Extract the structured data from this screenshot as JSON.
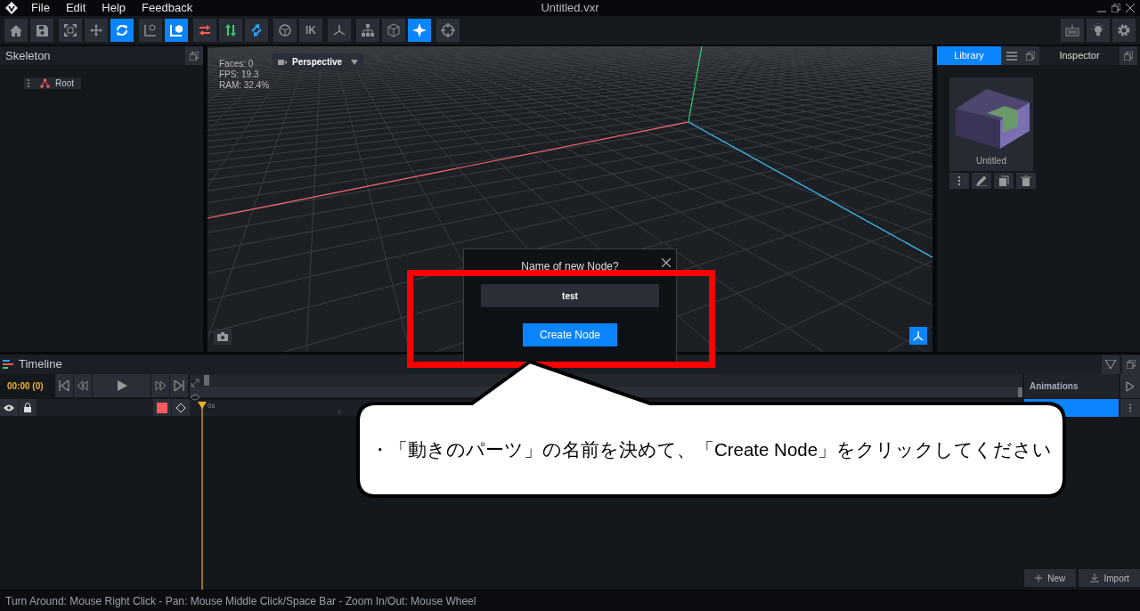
{
  "app": {
    "title": "Untitled.vxr",
    "menu": [
      "File",
      "Edit",
      "Help",
      "Feedback"
    ]
  },
  "toolbar": {
    "groups": [
      {
        "buttons": [
          {
            "selected": false
          },
          {
            "selected": false
          }
        ]
      },
      {
        "buttons": [
          {
            "selected": false
          },
          {
            "selected": false
          },
          {
            "selected": true
          }
        ]
      },
      {
        "buttons": [
          {
            "selected": false
          },
          {
            "selected": true
          }
        ]
      },
      {
        "buttons": [
          {
            "selected": false
          },
          {
            "selected": false
          },
          {
            "selected": false
          }
        ]
      },
      {
        "buttons": [
          {
            "selected": false
          },
          {
            "label": "IK",
            "selected": false
          }
        ]
      },
      {
        "buttons": [
          {
            "selected": false
          }
        ]
      },
      {
        "buttons": [
          {
            "selected": false
          },
          {
            "selected": false
          },
          {
            "selected": true
          }
        ]
      },
      {
        "buttons": [
          {
            "selected": false
          }
        ]
      }
    ],
    "right": [
      {
        "selected": false
      },
      {
        "selected": false
      },
      {
        "selected": false
      }
    ]
  },
  "skeleton": {
    "title": "Skeleton",
    "nodes": [
      {
        "label": "Root"
      }
    ]
  },
  "viewport": {
    "stats": [
      "Faces: 0",
      "FPS: 19.3",
      "RAM: 32.4%"
    ],
    "view_menu": "Perspective"
  },
  "library": {
    "tabs": [
      {
        "label": "Library",
        "selected": true
      },
      {
        "label": "Inspector",
        "selected": false
      }
    ],
    "items": [
      {
        "label": "Untitled"
      }
    ]
  },
  "dialog": {
    "title": "Name of new Node?",
    "value": "test",
    "button": "Create Node"
  },
  "callout": {
    "text": "・「動きのパーツ」の名前を決めて、「Create Node」をクリックしてください"
  },
  "timeline": {
    "title": "Timeline",
    "time": "00:00 (0)",
    "ruler_label": "0s"
  },
  "animations": {
    "title": "Animations",
    "items": [
      {
        "selected": true
      }
    ],
    "buttons": [
      "New",
      "Import"
    ]
  },
  "status_bar": "Turn Around: Mouse Right Click - Pan: Mouse Middle Click/Space Bar - Zoom In/Out: Mouse Wheel"
}
